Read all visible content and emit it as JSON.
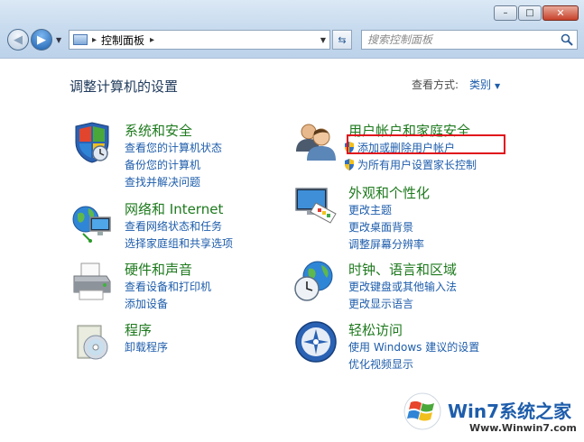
{
  "window": {
    "controls": {
      "minimize": "–",
      "maximize": "□",
      "close": "✕"
    }
  },
  "navigation": {
    "address_separator": "▸",
    "breadcrumb": "控制面板",
    "trailing_separator": "▸",
    "search_placeholder": "搜索控制面板"
  },
  "header": {
    "title": "调整计算机的设置",
    "view_by_label": "查看方式:",
    "view_by_value": "类别"
  },
  "categories": [
    {
      "title": "系统和安全",
      "icon": "shield-flag-icon",
      "links": [
        "查看您的计算机状态",
        "备份您的计算机",
        "查找并解决问题"
      ]
    },
    {
      "title": "网络和 Internet",
      "icon": "network-globe-icon",
      "links": [
        "查看网络状态和任务",
        "选择家庭组和共享选项"
      ]
    },
    {
      "title": "硬件和声音",
      "icon": "printer-icon",
      "links": [
        "查看设备和打印机",
        "添加设备"
      ]
    },
    {
      "title": "程序",
      "icon": "programs-disc-icon",
      "links": [
        "卸载程序"
      ]
    },
    {
      "title": "用户帐户和家庭安全",
      "icon": "users-icon",
      "links": [
        "添加或删除用户帐户",
        "为所有用户设置家长控制"
      ]
    },
    {
      "title": "外观和个性化",
      "icon": "monitor-palette-icon",
      "links": [
        "更改主题",
        "更改桌面背景",
        "调整屏幕分辨率"
      ]
    },
    {
      "title": "时钟、语言和区域",
      "icon": "clock-globe-icon",
      "links": [
        "更改键盘或其他输入法",
        "更改显示语言"
      ]
    },
    {
      "title": "轻松访问",
      "icon": "ease-of-access-icon",
      "links": [
        "使用 Windows 建议的设置",
        "优化视频显示"
      ]
    }
  ],
  "watermark": {
    "brand_prefix": "Win7",
    "brand_suffix": "系统之家",
    "url": "Www.Winwin7.com"
  },
  "colors": {
    "category_title": "#1e7a1e",
    "link": "#1e5dab",
    "heading": "#1e395b",
    "highlight_box": "#e0121b"
  }
}
